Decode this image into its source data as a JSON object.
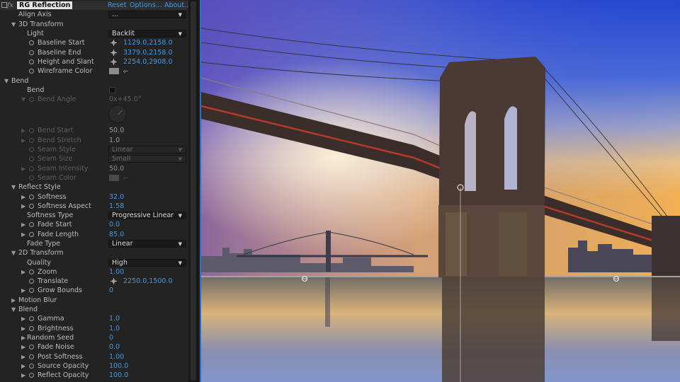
{
  "effect": {
    "fx_label": "fx",
    "name": "RG Reflection",
    "reset": "Reset",
    "options": "Options...",
    "about": "About..."
  },
  "rows": {
    "align_axis": {
      "label": "Align Axis",
      "value": "..."
    },
    "transform3d": {
      "label": "3D Transform"
    },
    "light": {
      "label": "Light",
      "value": "Backlit"
    },
    "baseline_start": {
      "label": "Baseline Start",
      "value": "1129.0,2158.0"
    },
    "baseline_end": {
      "label": "Baseline End",
      "value": "3379.0,2158.0"
    },
    "height_slant": {
      "label": "Height and Slant",
      "value": "2254.0,2908.0"
    },
    "wireframe_color": {
      "label": "Wireframe Color"
    },
    "bend_group": {
      "label": "Bend"
    },
    "bend": {
      "label": "Bend"
    },
    "bend_angle": {
      "label": "Bend Angle",
      "value": "0x+45.0°"
    },
    "bend_start": {
      "label": "Bend Start",
      "value": "50.0"
    },
    "bend_stretch": {
      "label": "Bend Stretch",
      "value": "1.0"
    },
    "seam_style": {
      "label": "Seam Style",
      "value": "Linear"
    },
    "seam_size": {
      "label": "Seam Size",
      "value": "Small"
    },
    "seam_intensity": {
      "label": "Seam Intensity",
      "value": "50.0"
    },
    "seam_color": {
      "label": "Seam Color"
    },
    "reflect_style": {
      "label": "Reflect Style"
    },
    "softness": {
      "label": "Softness",
      "value": "32.0"
    },
    "softness_aspect": {
      "label": "Softness Aspect",
      "value": "1.58"
    },
    "softness_type": {
      "label": "Softness Type",
      "value": "Progressive Linear"
    },
    "fade_start": {
      "label": "Fade Start",
      "value": "0.0"
    },
    "fade_length": {
      "label": "Fade Length",
      "value": "85.0"
    },
    "fade_type": {
      "label": "Fade Type",
      "value": "Linear"
    },
    "transform2d": {
      "label": "2D Transform"
    },
    "quality": {
      "label": "Quality",
      "value": "High"
    },
    "zoom": {
      "label": "Zoom",
      "value": "1.00"
    },
    "translate": {
      "label": "Translate",
      "value": "2250.0,1500.0"
    },
    "grow_bounds": {
      "label": "Grow Bounds",
      "value": "0"
    },
    "motion_blur": {
      "label": "Motion Blur"
    },
    "blend": {
      "label": "Blend"
    },
    "gamma": {
      "label": "Gamma",
      "value": "1.0"
    },
    "brightness": {
      "label": "Brightness",
      "value": "1.0"
    },
    "random_seed": {
      "label": "Random Seed",
      "value": "0"
    },
    "fade_noise": {
      "label": "Fade Noise",
      "value": "0.0"
    },
    "post_softness": {
      "label": "Post Softness",
      "value": "1.00"
    },
    "source_opacity": {
      "label": "Source Opacity",
      "value": "100.0"
    },
    "reflect_opacity": {
      "label": "Reflect Opacity",
      "value": "100.0"
    }
  },
  "colors": {
    "accent": "#3d9ae8",
    "panel_bg": "#232323",
    "selection": "#2b6fcc",
    "sky_top": "#2a4fd6",
    "sky_bottom": "#f3b05a"
  },
  "viewer": {
    "subject": "bridge-reflection-preview"
  }
}
